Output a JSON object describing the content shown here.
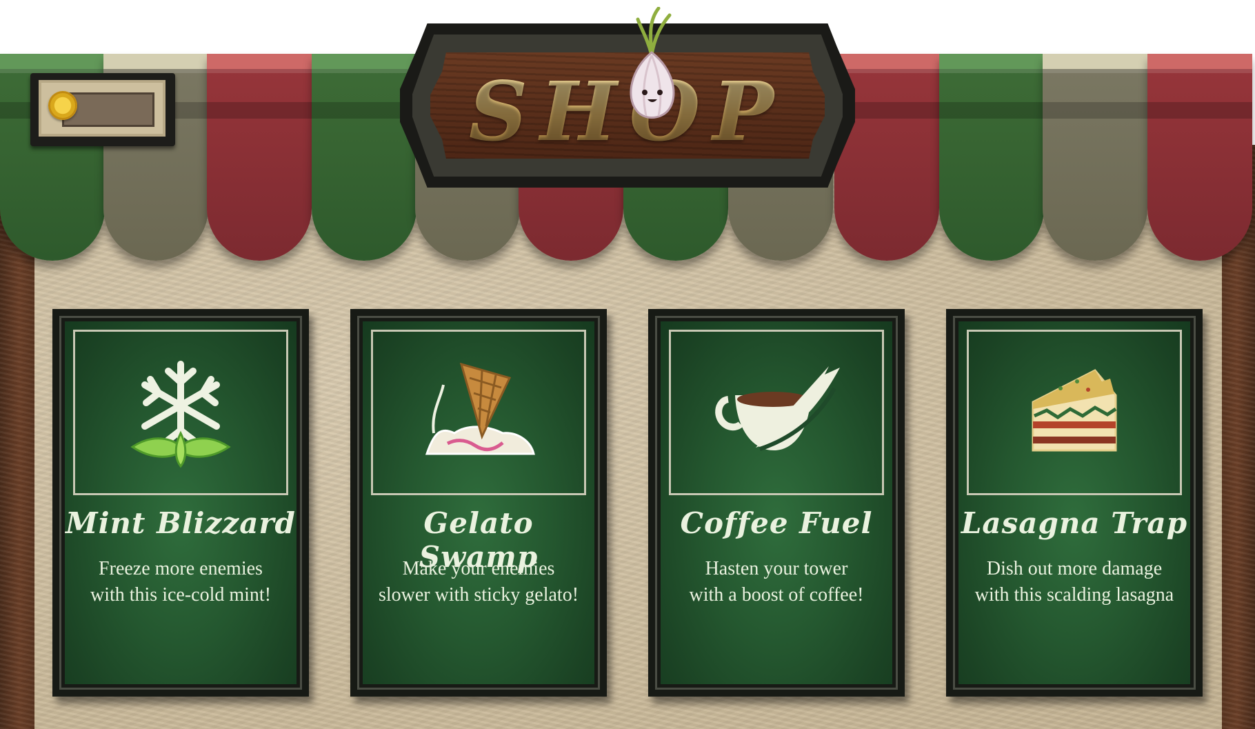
{
  "shop": {
    "title": "SHOP",
    "coins": ""
  },
  "colors": {
    "awning_green": "#3d6b36",
    "awning_gray": "#7a7762",
    "awning_red": "#96353a",
    "card_bg": "#24572f",
    "text": "#eaf2df",
    "sign_gold": "#d6b673"
  },
  "cards": [
    {
      "icon": "snowflake-mint-icon",
      "title": "Mint Blizzard",
      "desc_line1": "Freeze more enemies",
      "desc_line2": "with this ice-cold mint!"
    },
    {
      "icon": "gelato-cone-icon",
      "title": "Gelato Swamp",
      "desc_line1": "Make your enemies",
      "desc_line2": "slower with sticky gelato!"
    },
    {
      "icon": "coffee-cup-icon",
      "title": "Coffee Fuel",
      "desc_line1": "Hasten your tower",
      "desc_line2": "with a boost of coffee!"
    },
    {
      "icon": "lasagna-slice-icon",
      "title": "Lasagna Trap",
      "desc_line1": "Dish out more damage",
      "desc_line2": "with this scalding lasagna"
    }
  ]
}
